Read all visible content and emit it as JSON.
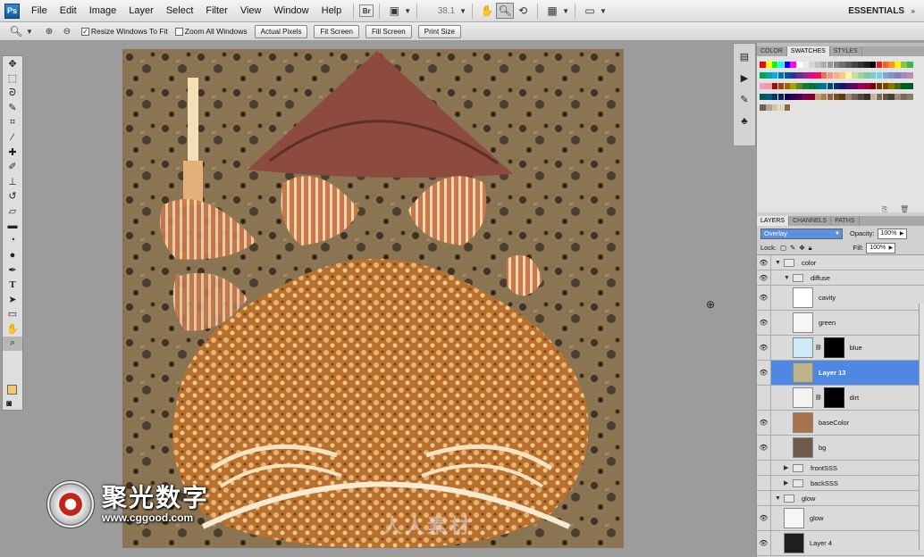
{
  "app": {
    "logo": "Ps",
    "workspace": "ESSENTIALS"
  },
  "menu": [
    "File",
    "Edit",
    "Image",
    "Layer",
    "Select",
    "Filter",
    "View",
    "Window",
    "Help"
  ],
  "appbar": {
    "bridge_icon": "Br",
    "zoom": "38.1"
  },
  "options": {
    "resize_windows": {
      "label": "Resize Windows To Fit",
      "checked": true
    },
    "zoom_all": {
      "label": "Zoom All Windows",
      "checked": false
    },
    "buttons": [
      "Actual Pixels",
      "Fit Screen",
      "Fill Screen",
      "Print Size"
    ]
  },
  "tools": [
    "move-icon",
    "marquee-icon",
    "lasso-icon",
    "quick-select-icon",
    "crop-icon",
    "eyedropper-icon",
    "healing-brush-icon",
    "brush-icon",
    "clone-stamp-icon",
    "history-brush-icon",
    "eraser-icon",
    "gradient-icon",
    "blur-icon",
    "dodge-icon",
    "pen-icon",
    "type-icon",
    "path-select-icon",
    "shape-icon",
    "hand-icon",
    "zoom-icon"
  ],
  "color_panel": {
    "tabs": [
      "COLOR",
      "SWATCHES",
      "STYLES"
    ],
    "active_tab": "SWATCHES",
    "swatches": [
      "#ff0000",
      "#ffff00",
      "#00ff00",
      "#00ffff",
      "#0000ff",
      "#ff00ff",
      "#ffffff",
      "#ebebeb",
      "#d6d6d6",
      "#c2c2c2",
      "#adadad",
      "#999999",
      "#858585",
      "#707070",
      "#5c5c5c",
      "#474747",
      "#333333",
      "#1f1f1f",
      "#000000",
      "#ed1c24",
      "#f26522",
      "#f7941d",
      "#fff200",
      "#8dc63f",
      "#39b54a",
      "#00a651",
      "#00a99d",
      "#00aeef",
      "#0072bc",
      "#0054a6",
      "#2e3192",
      "#662d91",
      "#92278f",
      "#ec008c",
      "#ed145b",
      "#f26c4f",
      "#f69679",
      "#f9ad81",
      "#fdc68a",
      "#fff799",
      "#c4df9b",
      "#a3d39c",
      "#82ca9c",
      "#7accc8",
      "#6dcff6",
      "#7da7d9",
      "#8393ca",
      "#8781bd",
      "#a187be",
      "#bd8cbf",
      "#f49ac1",
      "#f5989d",
      "#9e0b0f",
      "#a0410d",
      "#a36209",
      "#aba000",
      "#598527",
      "#1a7b30",
      "#007236",
      "#00746b",
      "#0076a3",
      "#004a80",
      "#003471",
      "#1b1464",
      "#440e62",
      "#630460",
      "#9e005d",
      "#9e0039",
      "#790000",
      "#7b2e00",
      "#7d4900",
      "#827b00",
      "#406618",
      "#005e20",
      "#005826",
      "#005952",
      "#005b7f",
      "#003663",
      "#002157",
      "#0d004c",
      "#32004b",
      "#4b0049",
      "#7b0046",
      "#7a0026",
      "#c69c6d",
      "#a67c52",
      "#8c6239",
      "#754c24",
      "#603913",
      "#998675",
      "#736357",
      "#534741",
      "#362f2d",
      "#c7b299",
      "#7d6a55",
      "#62523f",
      "#454035",
      "#9c8d7c",
      "#786b5c",
      "#8a7a6a",
      "#6f5f4e",
      "#b3a290",
      "#d1c2a9",
      "#e2d3b8",
      "#8a6a3a"
    ]
  },
  "layers_panel": {
    "tabs": [
      "LAYERS",
      "CHANNELS",
      "PATHS"
    ],
    "blend_mode": "Overlay",
    "opacity_label": "Opacity:",
    "opacity": "100%",
    "lock_label": "Lock:",
    "fill_label": "Fill:",
    "fill": "100%",
    "layers": [
      {
        "name": "color",
        "kind": "group",
        "expanded": true,
        "indent": 0,
        "visible": true
      },
      {
        "name": "diffuse",
        "kind": "group",
        "expanded": true,
        "indent": 1,
        "visible": true
      },
      {
        "name": "cavity",
        "kind": "layer",
        "indent": 2,
        "visible": true,
        "thumb": "#ffffff"
      },
      {
        "name": "green",
        "kind": "layer",
        "indent": 2,
        "visible": true,
        "thumb": "#f6f6f6"
      },
      {
        "name": "blue",
        "kind": "layer",
        "indent": 2,
        "visible": true,
        "thumb": "#cfeaf7",
        "mask": true
      },
      {
        "name": "Layer 13",
        "kind": "layer",
        "indent": 2,
        "visible": true,
        "thumb": "#bdb48a",
        "selected": true
      },
      {
        "name": "dirt",
        "kind": "layer",
        "indent": 2,
        "visible": false,
        "thumb": "#f3f3f3",
        "mask": true
      },
      {
        "name": "baseColor",
        "kind": "layer",
        "indent": 2,
        "visible": true,
        "thumb": "#a8734b"
      },
      {
        "name": "bg",
        "kind": "layer",
        "indent": 2,
        "visible": true,
        "thumb": "#6e5a4a"
      },
      {
        "name": "frontSSS",
        "kind": "group",
        "expanded": false,
        "indent": 1,
        "visible": false
      },
      {
        "name": "backSSS",
        "kind": "group",
        "expanded": false,
        "indent": 1,
        "visible": false
      },
      {
        "name": "glow",
        "kind": "group",
        "expanded": true,
        "indent": 0,
        "visible": false
      },
      {
        "name": "glow",
        "kind": "layer",
        "indent": 1,
        "visible": true,
        "thumb": "#f6f6f6"
      },
      {
        "name": "Layer 4",
        "kind": "layer",
        "indent": 1,
        "visible": true,
        "thumb": "#1e1e1e"
      }
    ]
  },
  "watermark": {
    "cn": "聚光数字",
    "url": "www.cggood.com",
    "site2": "人人素材"
  }
}
